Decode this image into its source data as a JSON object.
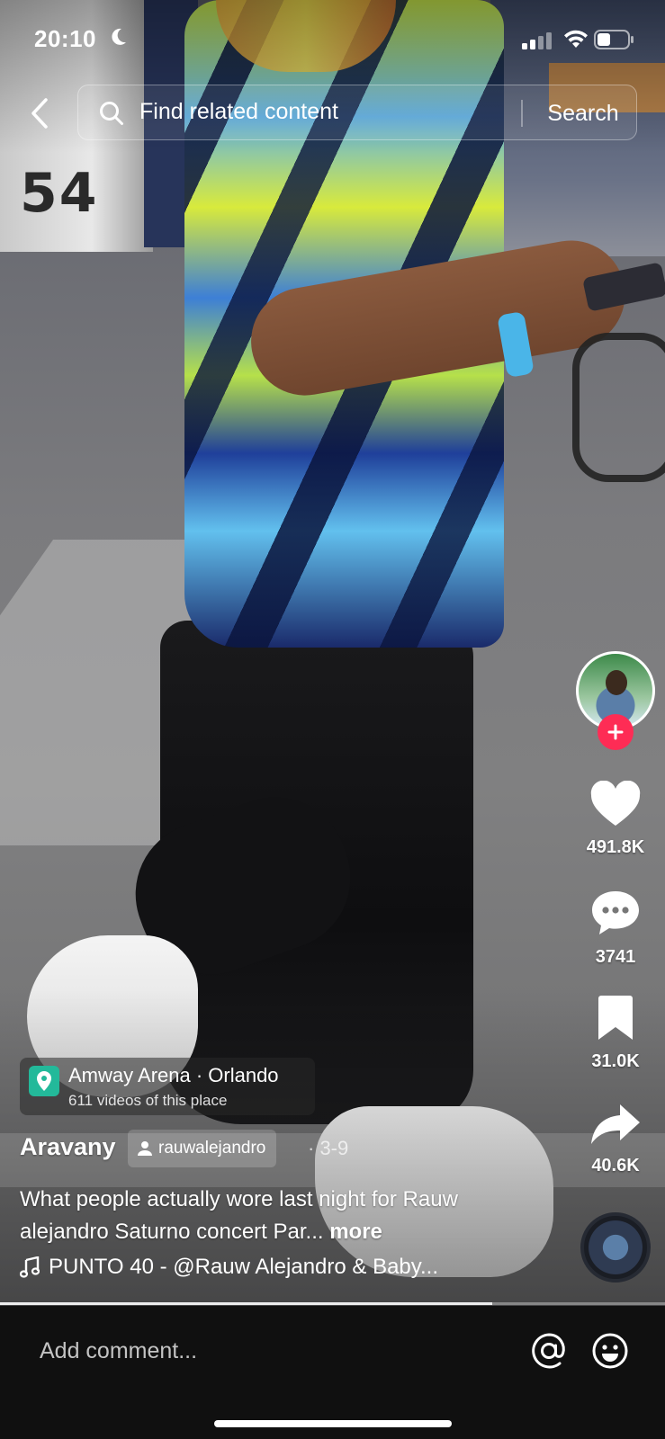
{
  "status_bar": {
    "time": "20:10"
  },
  "header": {
    "search_placeholder": "Find related content",
    "search_button": "Search"
  },
  "background": {
    "wall_numbers": "54"
  },
  "actions": {
    "likes": "491.8K",
    "comments": "3741",
    "saves": "31.0K",
    "shares": "40.6K"
  },
  "location": {
    "title": "Amway Arena · Orlando",
    "subtitle": "611 videos of this place"
  },
  "post": {
    "author": "Aravany",
    "mention": "rauwalejandro",
    "date": "· 3-9",
    "caption": "What people actually wore last night for Rauw alejandro Saturno concert Par...",
    "more_label": "more",
    "music": "PUNTO 40 - @Rauw Alejandro & Baby..."
  },
  "playback": {
    "progress": 0.74
  },
  "comment_bar": {
    "placeholder": "Add comment..."
  },
  "colors": {
    "follow": "#fe2c55",
    "location_pin": "#23b99a",
    "comment_bar": "#101010"
  }
}
